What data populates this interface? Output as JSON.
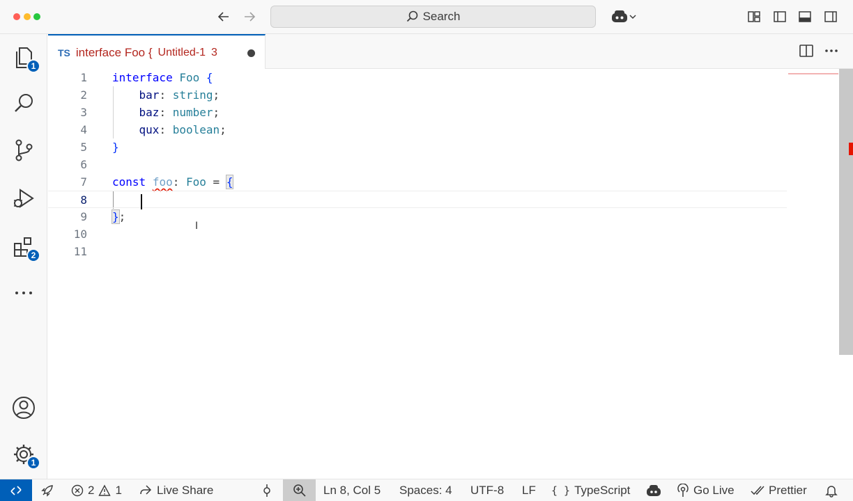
{
  "titlebar": {
    "search_label": "Search"
  },
  "activity": {
    "explorer_badge": "1",
    "extensions_badge": "2",
    "settings_badge": "1"
  },
  "tab": {
    "lang": "TS",
    "title": "interface Foo {",
    "description": "Untitled-1",
    "problem_count": "3"
  },
  "editor": {
    "line_numbers": [
      "1",
      "2",
      "3",
      "4",
      "5",
      "6",
      "7",
      "8",
      "9",
      "10",
      "11"
    ],
    "tokens": {
      "interface": "interface",
      "Foo": "Foo",
      "open_brace": "{",
      "close_brace": "}",
      "bar": "bar",
      "baz": "baz",
      "qux": "qux",
      "colon": ":",
      "semicolon": ";",
      "string": "string",
      "number": "number",
      "boolean": "boolean",
      "const": "const",
      "foo": "foo",
      "equals": "="
    },
    "active_line": 8
  },
  "statusbar": {
    "errors": "2",
    "warnings": "1",
    "live_share": "Live Share",
    "cursor_pos": "Ln 8, Col 5",
    "spaces": "Spaces: 4",
    "encoding": "UTF-8",
    "eol": "LF",
    "language": "TypeScript",
    "go_live": "Go Live",
    "prettier": "Prettier"
  },
  "colors": {
    "accent": "#005fb8",
    "error": "#e51400",
    "keyword": "#0000ff",
    "type": "#267f99",
    "property": "#001080"
  }
}
